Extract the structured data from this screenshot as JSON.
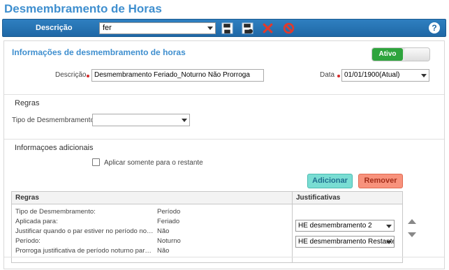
{
  "page": {
    "title": "Desmembramento de Horas"
  },
  "toolbar": {
    "label": "Descrição",
    "select_value": "fer",
    "save_icon": "save-icon",
    "save_as_icon": "save-as-icon",
    "delete_icon": "delete-x-icon",
    "cancel_icon": "cancel-icon",
    "help_label": "?"
  },
  "info": {
    "section_title": "Informações de desmembramento de horas",
    "status_toggle": {
      "label": "Ativo",
      "on": true,
      "color": "#2ea43d"
    },
    "descricao_label": "Descrição",
    "descricao_value": "Desmembramento Feriado_Noturno Não Prorroga",
    "data_label": "Data",
    "data_value": "01/01/1900(Atual)"
  },
  "regras": {
    "title": "Regras",
    "tipo_label": "Tipo de Desmembramento",
    "tipo_value": ""
  },
  "adicionais": {
    "title": "Informaçoes adicionais",
    "checkbox_label": "Aplicar somente para o restante",
    "checkbox_checked": false
  },
  "buttons": {
    "add": "Adicionar",
    "remove": "Remover"
  },
  "grid": {
    "col_rules": "Regras",
    "col_justificativas": "Justificativas",
    "rows": [
      {
        "label": "Tipo de Desmembramento:",
        "value": "Período"
      },
      {
        "label": "Aplicada para:",
        "value": "Feriado"
      },
      {
        "label": "Justificar quando o par estiver no período noturno:",
        "value": "Não"
      },
      {
        "label": "Período:",
        "value": "Noturno"
      },
      {
        "label": "Prorroga justificativa de período noturno para diur...",
        "value": "Não"
      }
    ],
    "justificativas": [
      {
        "value": "HE desmembramento 2"
      },
      {
        "value": "HE desmembramento Restante"
      }
    ]
  },
  "colors": {
    "title": "#3f8fcf",
    "toolbar": "#1f68a6",
    "add_button": "#79ddd3",
    "remove_button": "#f8927c",
    "required_marker": "#d62a2a"
  }
}
